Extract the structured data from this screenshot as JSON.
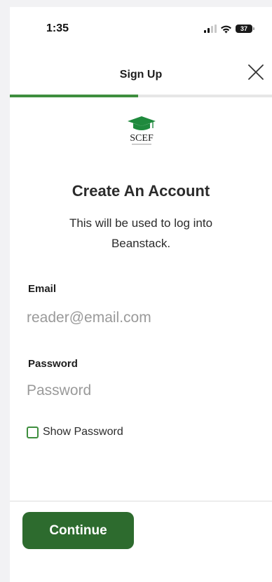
{
  "status_bar": {
    "time": "1:35",
    "battery": "37",
    "icons": [
      "signal-icon",
      "wifi-icon",
      "battery-icon"
    ]
  },
  "header": {
    "title": "Sign Up",
    "close_icon": "close-icon"
  },
  "progress": {
    "fraction": 0.49,
    "fill_color": "#3e8e3e"
  },
  "logo": {
    "text": "SCEF",
    "icon": "graduation-cap-icon"
  },
  "main": {
    "heading": "Create An Account",
    "subtext": "This will be used to log into Beanstack."
  },
  "form": {
    "email_label": "Email",
    "email_placeholder": "reader@email.com",
    "password_label": "Password",
    "password_placeholder": "Password",
    "show_password_label": "Show Password",
    "show_password_checked": false
  },
  "footer": {
    "continue_label": "Continue",
    "button_color": "#2d6b2e"
  }
}
